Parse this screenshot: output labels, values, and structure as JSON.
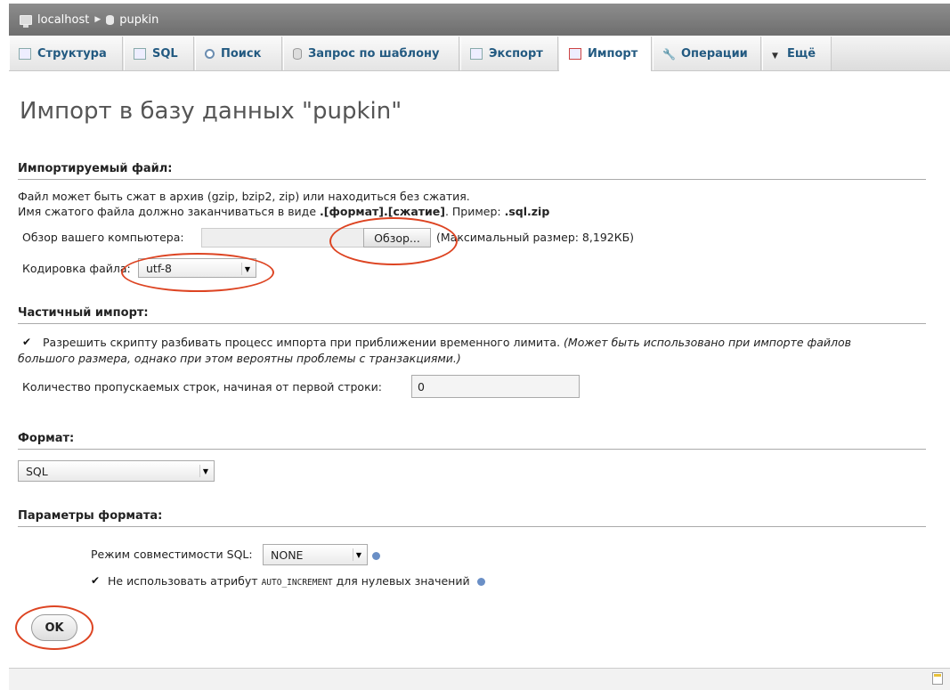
{
  "breadcrumb": {
    "server": "localhost",
    "database": "pupkin"
  },
  "tabs": [
    {
      "label": "Структура",
      "icon": "structure-icon"
    },
    {
      "label": "SQL",
      "icon": "sql-icon"
    },
    {
      "label": "Поиск",
      "icon": "search-icon"
    },
    {
      "label": "Запрос по шаблону",
      "icon": "query-icon"
    },
    {
      "label": "Экспорт",
      "icon": "export-icon"
    },
    {
      "label": "Импорт",
      "icon": "import-icon",
      "active": true
    },
    {
      "label": "Операции",
      "icon": "wrench-icon"
    },
    {
      "label": "Ещё",
      "icon": "chevron-down-icon"
    }
  ],
  "page_title": "Импорт в базу данных \"pupkin\"",
  "file_section": {
    "heading": "Импортируемый файл:",
    "line1": "Файл может быть сжат в архив (gzip, bzip2, zip) или находиться без сжатия.",
    "line2_prefix": "Имя сжатого файла должно заканчиваться в виде ",
    "line2_bold": ".[формат].[сжатие]",
    "line2_mid": ". Пример: ",
    "line2_example": ".sql.zip",
    "browse_label": "Обзор вашего компьютера:",
    "browse_button": "Обзор...",
    "max_size": "(Максимальный размер: 8,192КБ)",
    "encoding_label": "Кодировка файла:",
    "encoding_value": "utf-8"
  },
  "partial_section": {
    "heading": "Частичный импорт:",
    "allow_interrupt": "Разрешить скрипту разбивать процесс импорта при приближении временного лимита.",
    "allow_interrupt_note1": "(Может быть использовано при импорте файлов",
    "allow_interrupt_note2": "большого размера, однако при этом вероятны проблемы с транзакциями.)",
    "allow_interrupt_checked": true,
    "skip_label": "Количество пропускаемых строк, начиная от первой строки:",
    "skip_value": "0"
  },
  "format_section": {
    "heading": "Формат:",
    "value": "SQL"
  },
  "format_options": {
    "heading": "Параметры формата:",
    "compat_label": "Режим совместимости SQL:",
    "compat_value": "NONE",
    "auto_inc_label_prefix": "Не использовать атрибут",
    "auto_inc_code": "AUTO_INCREMENT",
    "auto_inc_label_suffix": "для нулевых значений",
    "auto_inc_checked": true
  },
  "ok_button": "OK",
  "colors": {
    "annotation": "#d42222",
    "link": "#235a81"
  }
}
